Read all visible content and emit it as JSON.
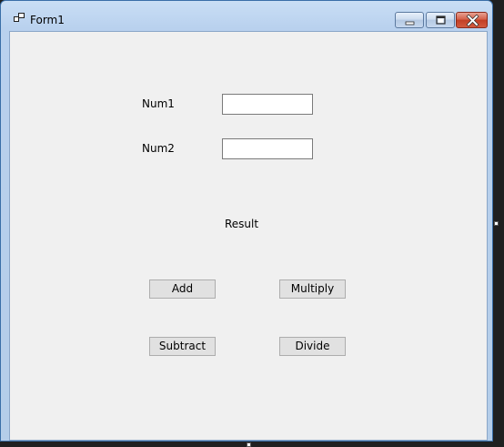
{
  "window": {
    "title": "Form1",
    "icon": "form-icon",
    "minimize_icon": "minimize-icon",
    "maximize_icon": "maximize-icon",
    "close_icon": "close-icon"
  },
  "form": {
    "num1_label": "Num1",
    "num1_value": "",
    "num2_label": "Num2",
    "num2_value": "",
    "result_label": "Result",
    "buttons": {
      "add": "Add",
      "multiply": "Multiply",
      "subtract": "Subtract",
      "divide": "Divide"
    }
  },
  "colors": {
    "titlebar": "#b9d1ee",
    "client_background": "#f0f0f0",
    "close_button": "#c23e24",
    "button_face": "#e1e1e1"
  }
}
